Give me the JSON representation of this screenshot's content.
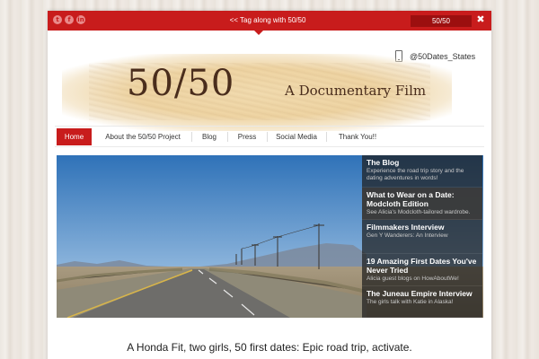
{
  "topbar": {
    "social_icons": [
      {
        "name": "twitter-icon",
        "glyph": "t"
      },
      {
        "name": "facebook-icon",
        "glyph": "f"
      },
      {
        "name": "linkedin-icon",
        "glyph": "in"
      }
    ],
    "tagline_link": "<< Tag along with 50/50",
    "search_value": "50/50",
    "close_glyph": "✖",
    "accent_color": "#c81c1c"
  },
  "header": {
    "handle": "@50Dates_States",
    "banner_title": "50/50",
    "banner_subtitle": "A Documentary Film"
  },
  "nav": {
    "items": [
      {
        "label": "Home",
        "active": true
      },
      {
        "label": "About the 50/50 Project",
        "active": false
      },
      {
        "label": "Blog",
        "active": false
      },
      {
        "label": "Press",
        "active": false
      },
      {
        "label": "Social Media",
        "active": false
      },
      {
        "label": "Thank You!!",
        "active": false
      }
    ]
  },
  "slider": {
    "slides": [
      {
        "title": "The Blog",
        "desc": "Experience the road trip story and the dating adventures in words!"
      },
      {
        "title": "What to Wear on a Date: Modcloth Edition",
        "desc": "See Alicia's Modcloth-tailored wardrobe."
      },
      {
        "title": "Filmmakers Interview",
        "desc": "Gen Y Wanderers: An Interview"
      },
      {
        "title": "19 Amazing First Dates You've Never Tried",
        "desc": "Alicia guest blogs on HowAboutWe!"
      },
      {
        "title": "The Juneau Empire Interview",
        "desc": "The girls talk with Katie in Alaska!"
      }
    ]
  },
  "main": {
    "tagline": "A Honda Fit, two girls, 50 first dates: Epic road trip, activate."
  }
}
